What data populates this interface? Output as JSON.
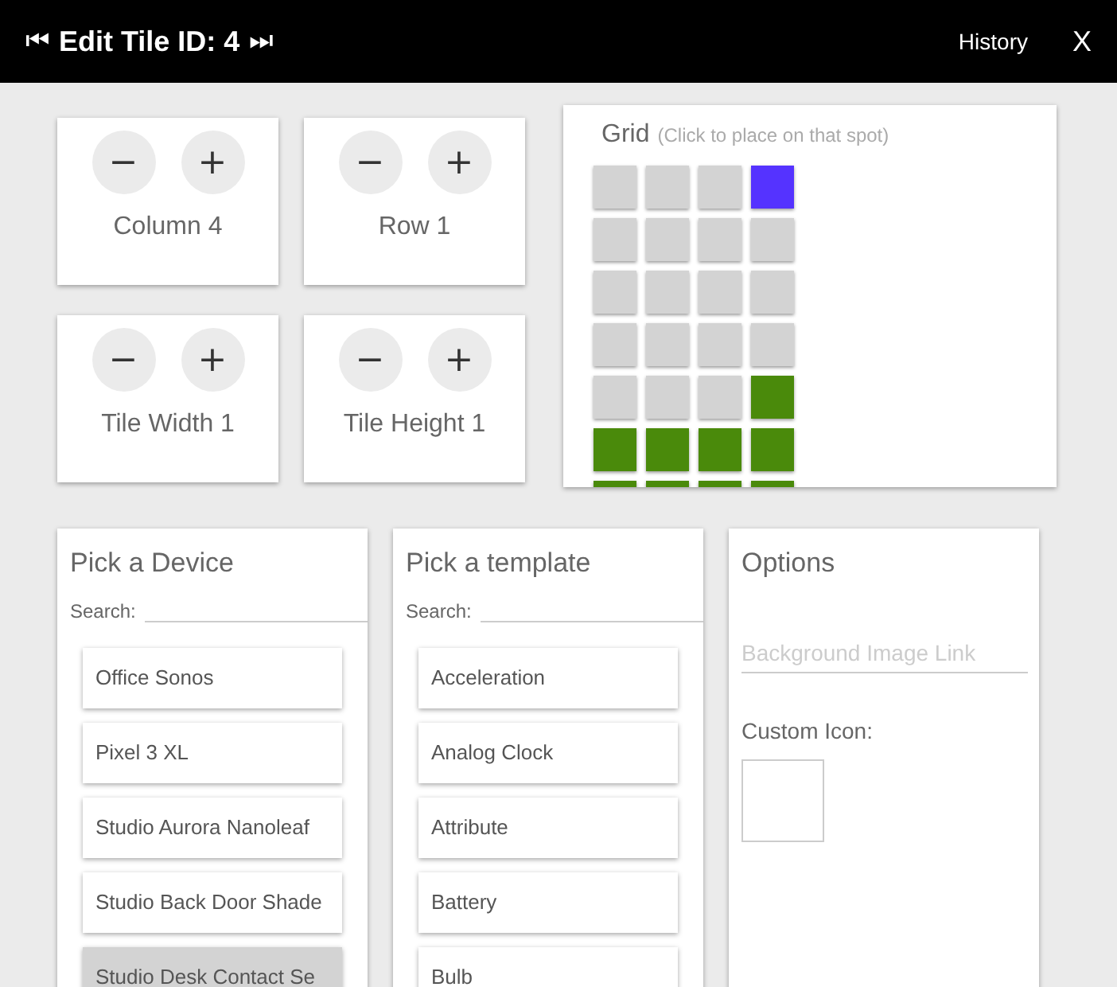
{
  "header": {
    "prev_icon": "⏮",
    "title": "Edit Tile ID: 4",
    "next_icon": "⏭",
    "history": "History",
    "close": "X"
  },
  "steppers": [
    {
      "minus": "−",
      "plus": "+",
      "label": "Column 4"
    },
    {
      "minus": "−",
      "plus": "+",
      "label": "Row 1"
    },
    {
      "minus": "−",
      "plus": "+",
      "label": "Tile Width 1"
    },
    {
      "minus": "−",
      "plus": "+",
      "label": "Tile Height 1"
    }
  ],
  "grid": {
    "title": "Grid",
    "hint": "(Click to place on that spot)",
    "rows": [
      {
        "cells": [
          {
            "kind": "empty"
          },
          {
            "kind": "empty"
          },
          {
            "kind": "empty"
          },
          {
            "kind": "current"
          }
        ]
      },
      {
        "cells": [
          {
            "kind": "empty"
          },
          {
            "kind": "empty"
          },
          {
            "kind": "empty"
          },
          {
            "kind": "empty"
          }
        ]
      },
      {
        "cells": [
          {
            "kind": "empty"
          },
          {
            "kind": "empty"
          },
          {
            "kind": "empty"
          },
          {
            "kind": "empty"
          }
        ]
      },
      {
        "cells": [
          {
            "kind": "empty"
          },
          {
            "kind": "empty"
          },
          {
            "kind": "empty"
          },
          {
            "kind": "empty"
          }
        ]
      },
      {
        "cells": [
          {
            "kind": "empty"
          },
          {
            "kind": "empty"
          },
          {
            "kind": "empty"
          },
          {
            "kind": "occupied"
          }
        ]
      },
      {
        "cells": [
          {
            "kind": "occupied"
          },
          {
            "kind": "occupied"
          },
          {
            "kind": "occupied"
          },
          {
            "kind": "occupied"
          }
        ]
      },
      {
        "cells": [
          {
            "kind": "occupied"
          },
          {
            "kind": "occupied"
          },
          {
            "kind": "occupied"
          },
          {
            "kind": "occupied"
          }
        ]
      }
    ]
  },
  "device_panel": {
    "title": "Pick a Device",
    "search_label": "Search:",
    "items": [
      {
        "label": "Office Sonos",
        "selected": false
      },
      {
        "label": "Pixel 3 XL",
        "selected": false
      },
      {
        "label": "Studio Aurora Nanoleaf",
        "selected": false
      },
      {
        "label": "Studio Back Door Shade",
        "selected": false
      },
      {
        "label": "Studio Desk Contact Se",
        "selected": true
      }
    ]
  },
  "template_panel": {
    "title": "Pick a template",
    "search_label": "Search:",
    "items": [
      {
        "label": "Acceleration",
        "selected": false
      },
      {
        "label": "Analog Clock",
        "selected": false
      },
      {
        "label": "Attribute",
        "selected": false
      },
      {
        "label": "Battery",
        "selected": false
      },
      {
        "label": "Bulb",
        "selected": false
      }
    ]
  },
  "options": {
    "title": "Options",
    "background_placeholder": "Background Image Link",
    "custom_icon_label": "Custom Icon:"
  }
}
